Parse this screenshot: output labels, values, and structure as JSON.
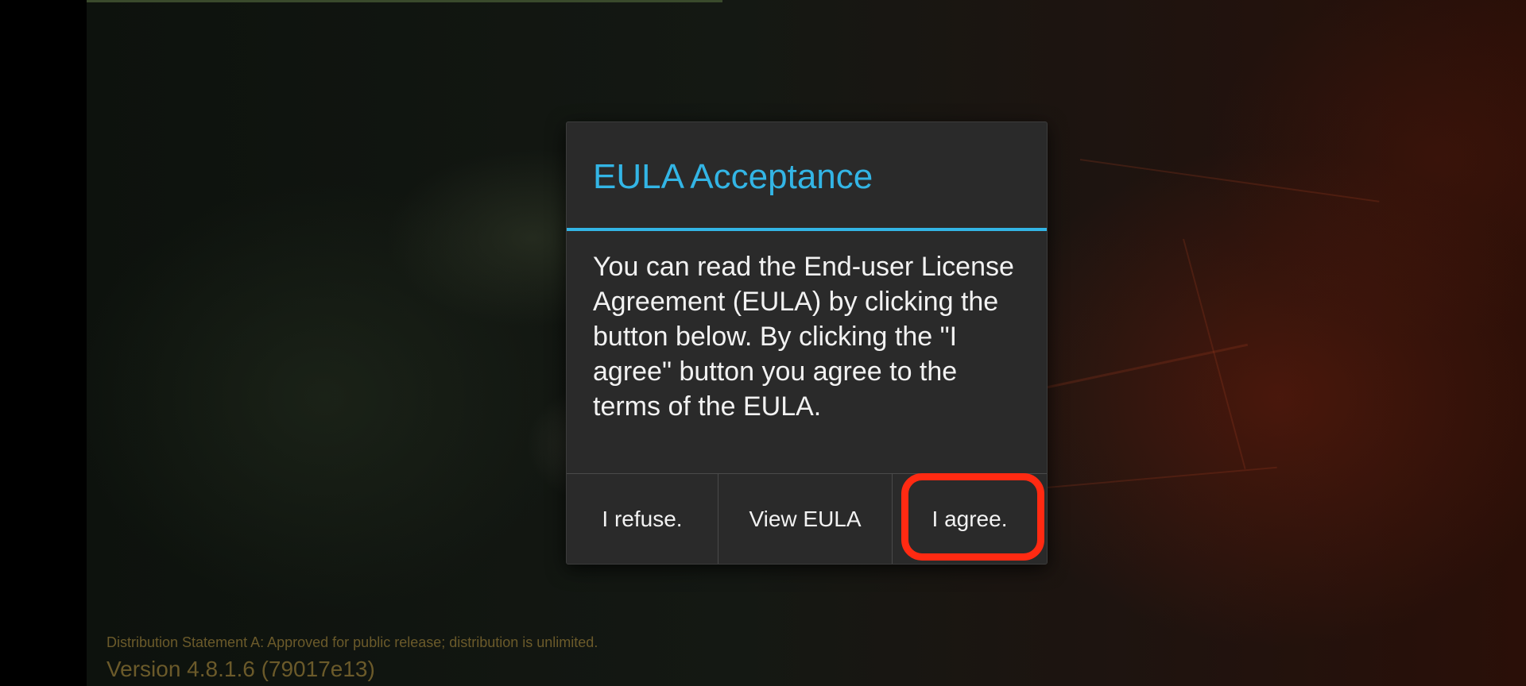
{
  "dialog": {
    "title": "EULA Acceptance",
    "message": "You can read the End-user License Agreement (EULA) by clicking the button below. By clicking the \"I agree\" button you agree to the terms of the EULA.",
    "buttons": {
      "refuse": "I refuse.",
      "view": "View EULA",
      "agree": "I agree."
    }
  },
  "footer": {
    "distribution": "Distribution Statement A: Approved for public release; distribution is unlimited.",
    "version": "Version 4.8.1.6 (79017e13)"
  },
  "colors": {
    "accent": "#33b5e5",
    "highlight": "#ff2a12",
    "dialog_bg": "#2a2a2a",
    "footer_text": "#6b5a2a"
  }
}
